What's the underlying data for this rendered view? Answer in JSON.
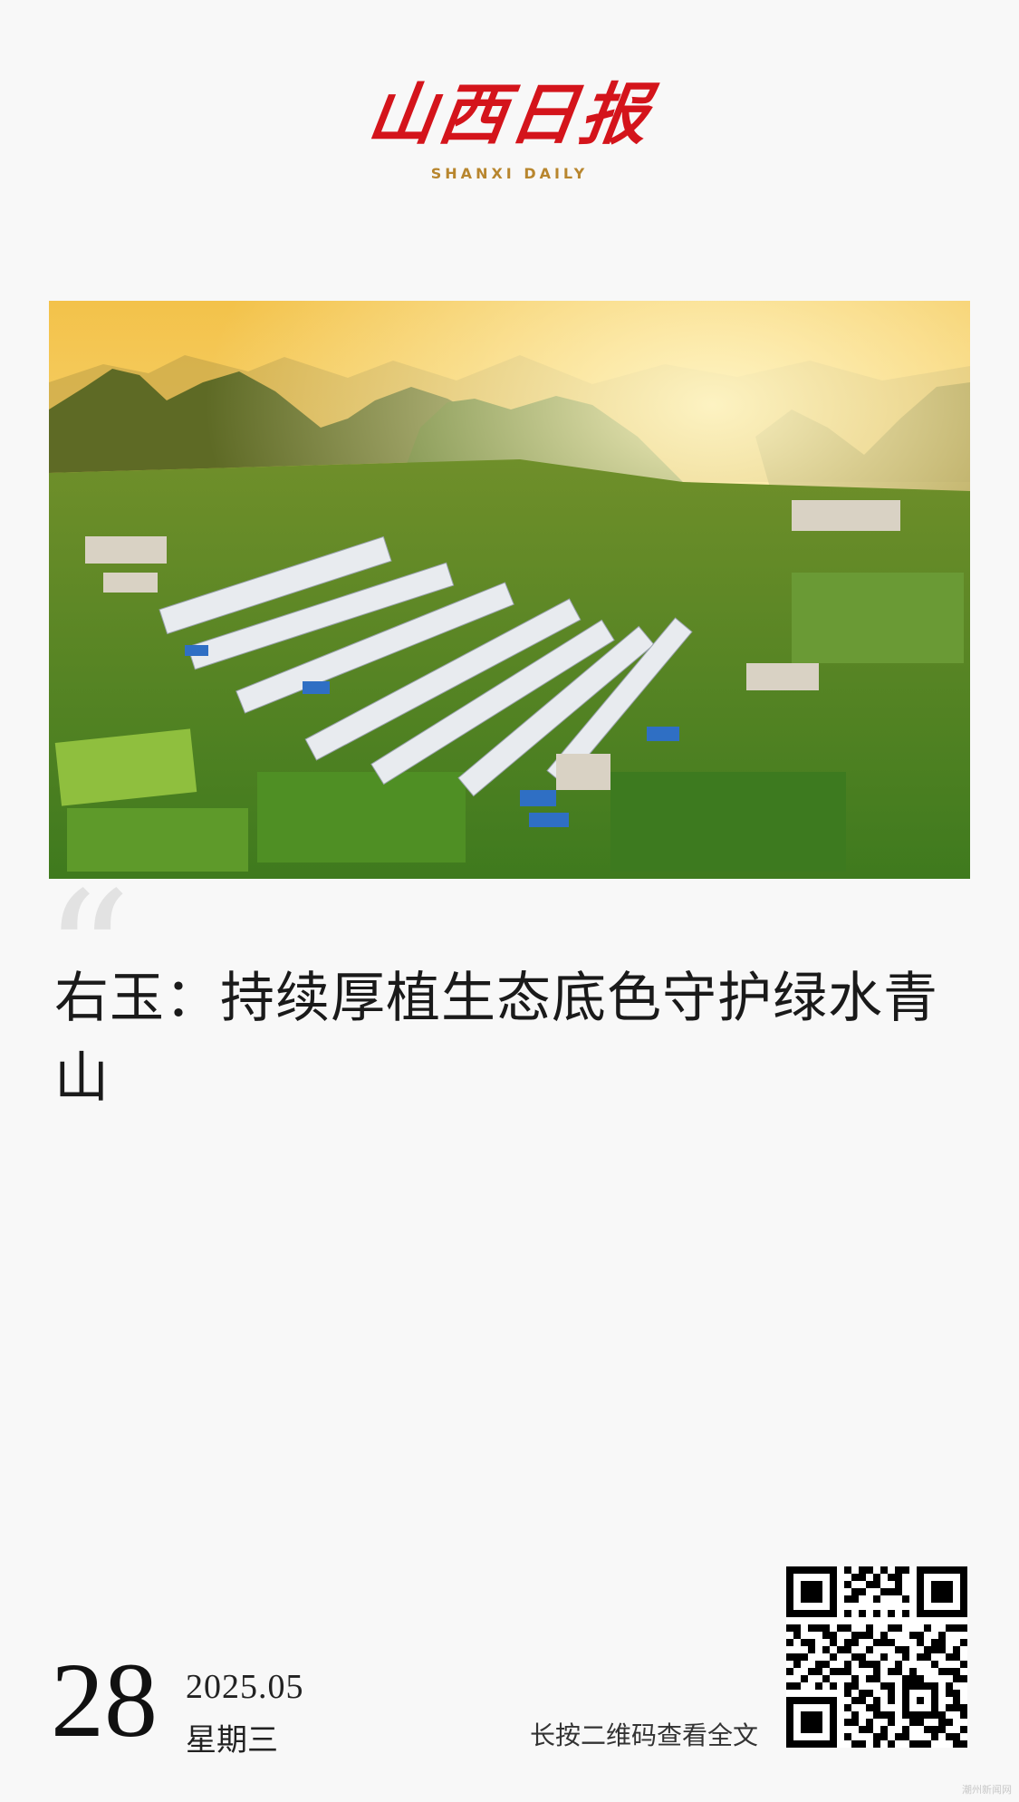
{
  "masthead": {
    "logo_cn": "山西日报",
    "logo_en": "SHANXI DAILY"
  },
  "hero_image": {
    "icon": "village-landscape-photo"
  },
  "article": {
    "quote_mark": "“",
    "headline": "右玉：持续厚植生态底色守护绿水青山"
  },
  "date": {
    "day": "28",
    "year_month": "2025.05",
    "weekday": "星期三"
  },
  "qr": {
    "hint": "长按二维码查看全文",
    "icon": "qr-code-icon"
  },
  "watermark": "潮州新闻网",
  "colors": {
    "brand_red": "#d4141b",
    "brand_gold": "#b8862e",
    "background": "#f8f8f8"
  }
}
